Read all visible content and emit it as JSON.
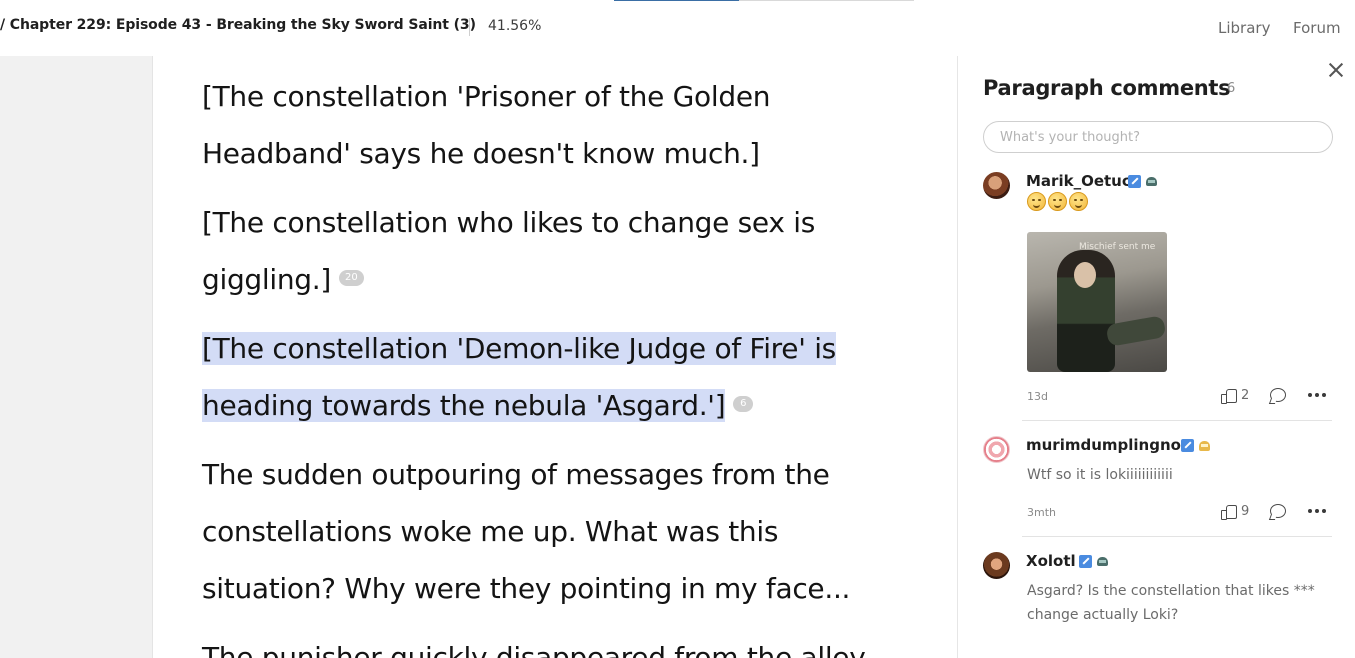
{
  "header": {
    "chapter_title": "/ Chapter 229: Episode 43 - Breaking the Sky Sword Saint (3)",
    "progress": "41.56%",
    "nav": {
      "library": "Library",
      "forum": "Forum"
    }
  },
  "reader": {
    "paragraphs": [
      {
        "lines": [
          "[The constellation 'Prisoner of the Golden",
          "Headband' says he doesn't know much.]"
        ],
        "comment_count": ""
      },
      {
        "lines": [
          "[The constellation who likes to change sex is",
          "giggling.]"
        ],
        "comment_count": "20"
      },
      {
        "lines": [
          "[The constellation 'Demon-like Judge of Fire' is",
          "heading towards the nebula 'Asgard.']"
        ],
        "comment_count": "6",
        "highlighted": true
      },
      {
        "lines": [
          "The sudden outpouring of messages from the",
          "constellations woke me up. What was this",
          "situation? Why were they pointing in my face..."
        ],
        "comment_count": ""
      },
      {
        "lines": [
          "The punisher quickly disappeared from the alley"
        ],
        "comment_count": ""
      }
    ]
  },
  "comments_panel": {
    "title": "Paragraph comments",
    "count": "6",
    "input_placeholder": "What's your thought?",
    "comments": [
      {
        "username": "Marik_Oetuc",
        "time": "13d",
        "likes": "2",
        "has_emojis": true,
        "gif_caption": "Mischief sent me"
      },
      {
        "username": "murimdumplingno1",
        "text": "Wtf so it is lokiiiiiiiiiiii",
        "time": "3mth",
        "likes": "9"
      },
      {
        "username": "Xolotl",
        "text": "Asgard? Is the constellation that likes *** change actually Loki?"
      }
    ]
  },
  "colors": {
    "highlight": "#d3dcf6",
    "accent": "#3a6ea5"
  }
}
